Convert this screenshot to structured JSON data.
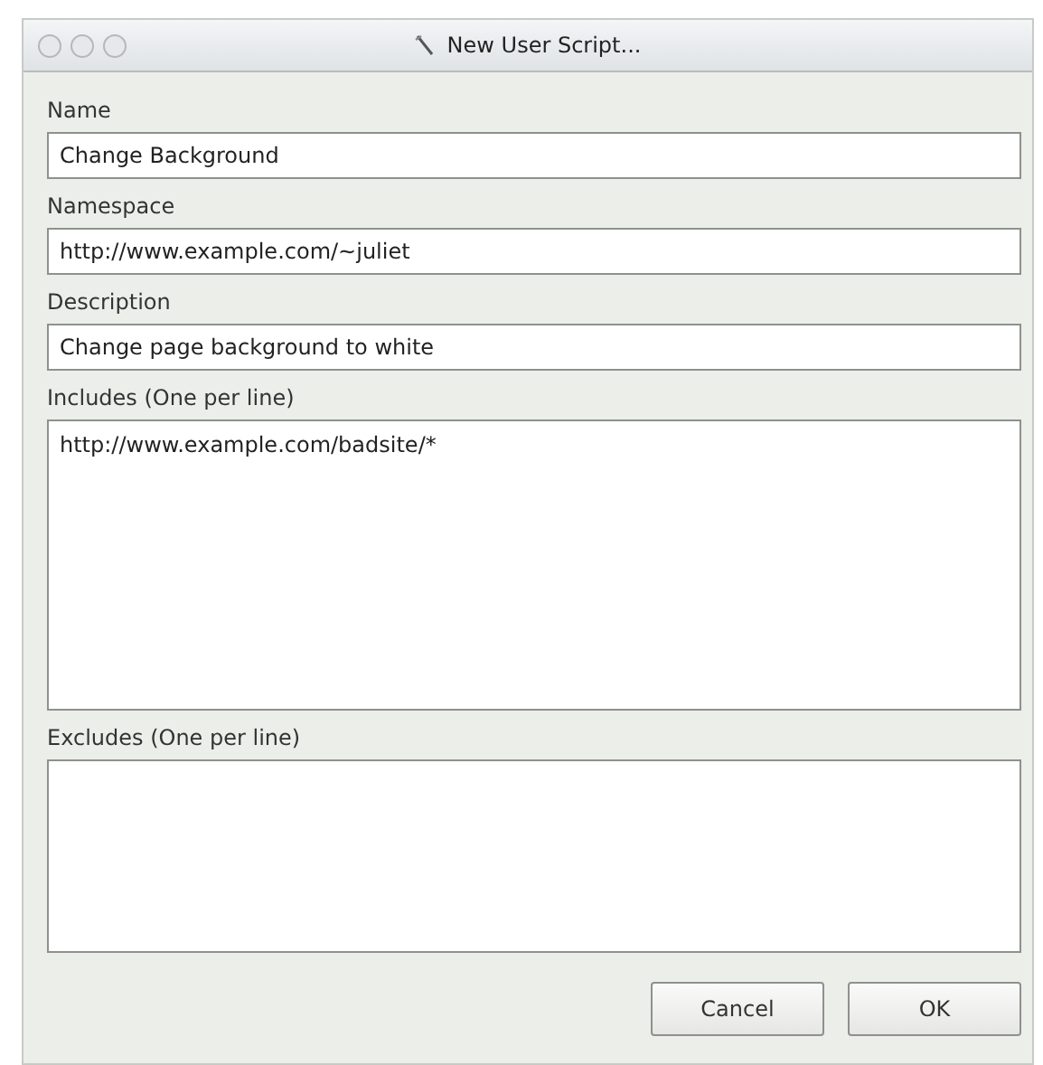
{
  "window": {
    "title": "New User Script..."
  },
  "fields": [
    {
      "label": "Name",
      "value": "Change Background",
      "kind": "line"
    },
    {
      "label": "Namespace",
      "value": "http://www.example.com/~juliet",
      "kind": "line"
    },
    {
      "label": "Description",
      "value": "Change page background to white",
      "kind": "line"
    },
    {
      "label": "Includes (One per line)",
      "value": "http://www.example.com/badsite/*",
      "kind": "multi"
    },
    {
      "label": "Excludes (One per line)",
      "kind": "multi"
    }
  ],
  "buttons": [
    "Cancel",
    "OK"
  ]
}
